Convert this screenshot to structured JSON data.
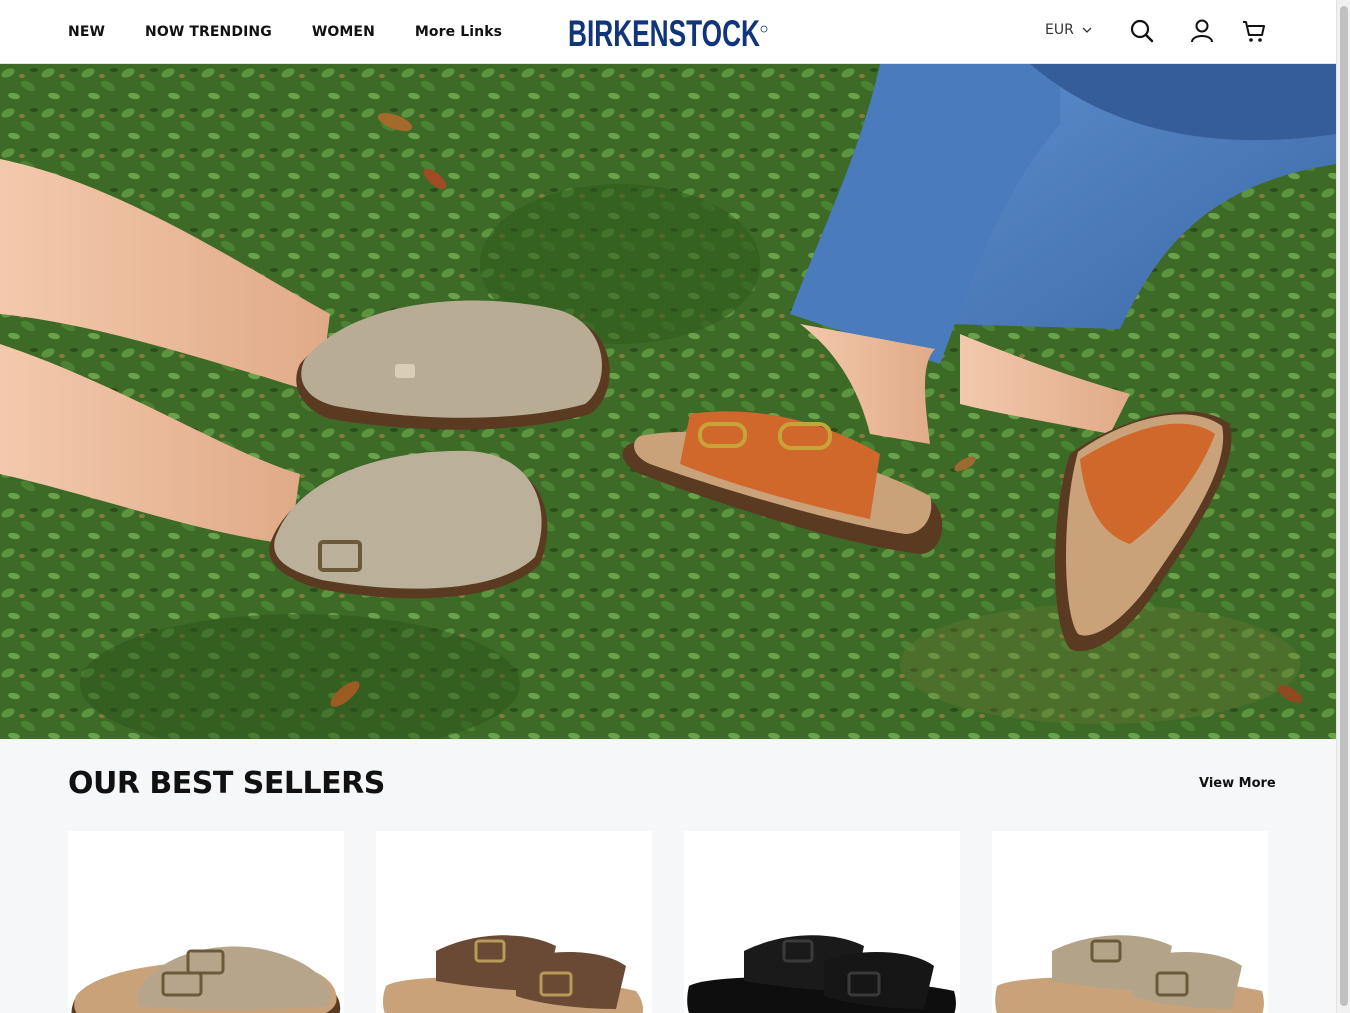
{
  "header": {
    "nav": [
      "NEW",
      "NOW TRENDING",
      "WOMEN",
      "More Links"
    ],
    "logo_text": "BIRKENSTOCK",
    "currency": "EUR"
  },
  "hero": {
    "icons": [
      "grass-background",
      "clog-shoe",
      "sandal-shoe",
      "denim-leg"
    ]
  },
  "best_sellers": {
    "title": "OUR BEST SELLERS",
    "view_more": "View More",
    "products": [
      {
        "color": "#b7a58b",
        "style": "clog"
      },
      {
        "color": "#6a4a34",
        "style": "sandal"
      },
      {
        "color": "#161616",
        "style": "sandal"
      },
      {
        "color": "#b3a489",
        "style": "sandal"
      }
    ]
  },
  "colors": {
    "brand": "#11357a",
    "grass": "#3f6b2a",
    "denim": "#4f7fc0",
    "orange_leather": "#d0682b",
    "suede": "#b9ac95"
  }
}
